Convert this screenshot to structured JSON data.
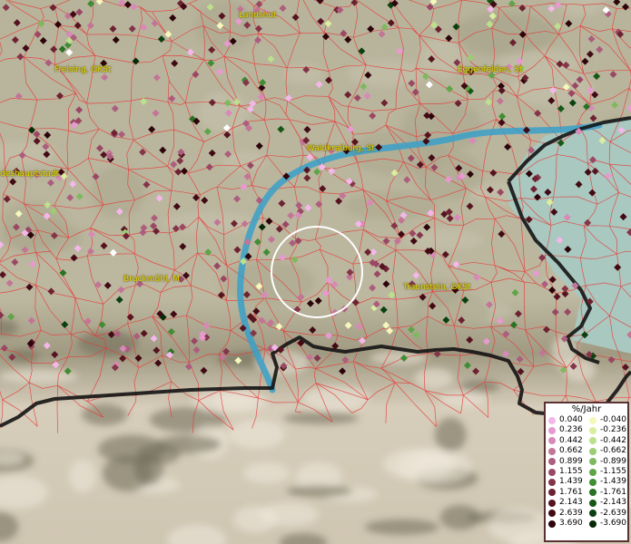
{
  "places": [
    {
      "id": "landshut",
      "label": "Landshut"
    },
    {
      "id": "freising",
      "label": "Freising, GKSt"
    },
    {
      "id": "eggenfelden",
      "label": "Eggenfelden, St"
    },
    {
      "id": "waldkraiburg",
      "label": "Waldkraiburg, St"
    },
    {
      "id": "landeshauptstadt",
      "label": "deshauptstadt"
    },
    {
      "id": "bruckmuehl",
      "label": "Bruckmühl, M"
    },
    {
      "id": "traunstein",
      "label": "Traunstein, GKSt"
    }
  ],
  "legend": {
    "title": "%/Jahr",
    "positive": [
      {
        "label": "0.040",
        "color": "#f3b7ea"
      },
      {
        "label": "0.236",
        "color": "#e79ad0"
      },
      {
        "label": "0.442",
        "color": "#d889b8"
      },
      {
        "label": "0.662",
        "color": "#c37597"
      },
      {
        "label": "0.899",
        "color": "#ad5d7d"
      },
      {
        "label": "1.155",
        "color": "#9a4864"
      },
      {
        "label": "1.439",
        "color": "#843549"
      },
      {
        "label": "1.761",
        "color": "#6d2232"
      },
      {
        "label": "2.143",
        "color": "#561420"
      },
      {
        "label": "2.639",
        "color": "#410a14"
      },
      {
        "label": "3.690",
        "color": "#2c040a"
      }
    ],
    "negative": [
      {
        "label": "-0.040",
        "color": "#f4f8bb"
      },
      {
        "label": "-0.236",
        "color": "#d9ee9f"
      },
      {
        "label": "-0.442",
        "color": "#bde08c"
      },
      {
        "label": "-0.662",
        "color": "#9ccd73"
      },
      {
        "label": "-0.899",
        "color": "#7fb95f"
      },
      {
        "label": "-1.155",
        "color": "#5fa548"
      },
      {
        "label": "-1.439",
        "color": "#418d33"
      },
      {
        "label": "-1.761",
        "color": "#2a7223"
      },
      {
        "label": "-2.143",
        "color": "#175816"
      },
      {
        "label": "-2.639",
        "color": "#0b4010"
      },
      {
        "label": "-3.690",
        "color": "#052a08"
      }
    ]
  },
  "colors": {
    "district_border": "#e83838",
    "country_border": "#141414",
    "river": "#3aa0c8",
    "lake": "#a9c8bf",
    "highlight_circle": "#ffffff"
  }
}
